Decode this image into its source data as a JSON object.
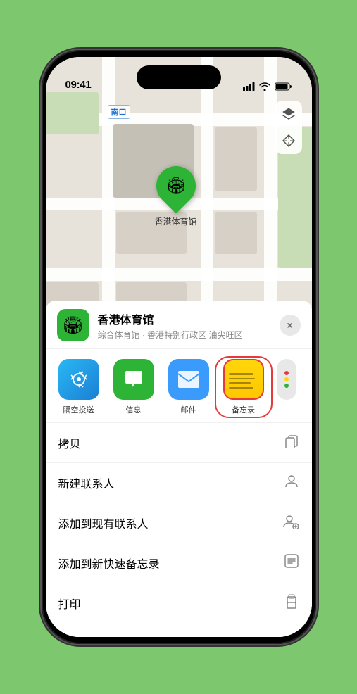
{
  "status_bar": {
    "time": "09:41",
    "location_icon": "▶"
  },
  "map": {
    "label_south_entrance": "南口",
    "pin_label": "香港体育馆",
    "btn_map_layers": "🗺",
    "btn_location": "➤"
  },
  "sheet": {
    "venue_icon": "🏟",
    "venue_name": "香港体育馆",
    "venue_subtitle": "综合体育馆 · 香港特别行政区 油尖旺区",
    "close_label": "×",
    "share_items": [
      {
        "id": "airdrop",
        "label": "隔空投送"
      },
      {
        "id": "messages",
        "label": "信息"
      },
      {
        "id": "mail",
        "label": "邮件"
      },
      {
        "id": "notes",
        "label": "备忘录"
      }
    ],
    "menu_items": [
      {
        "id": "copy",
        "label": "拷贝",
        "icon": "⎘"
      },
      {
        "id": "new-contact",
        "label": "新建联系人",
        "icon": "👤"
      },
      {
        "id": "add-existing",
        "label": "添加到现有联系人",
        "icon": "👤+"
      },
      {
        "id": "add-quick-note",
        "label": "添加到新快速备忘录",
        "icon": "📋"
      },
      {
        "id": "print",
        "label": "打印",
        "icon": "🖨"
      }
    ]
  }
}
